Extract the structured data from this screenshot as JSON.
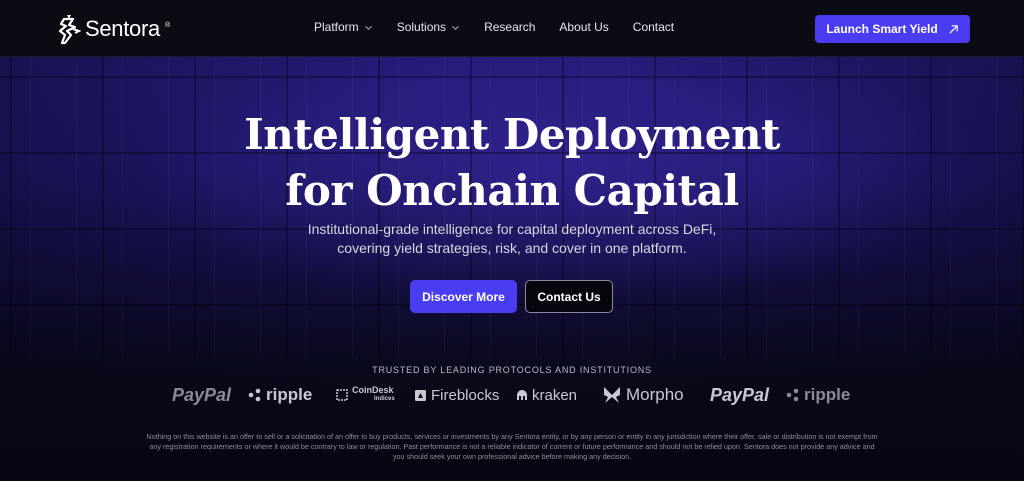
{
  "nav": {
    "logo_text": "Sentora",
    "logo_reg": "®",
    "menu": [
      {
        "label": "Platform",
        "has_dropdown": true
      },
      {
        "label": "Solutions",
        "has_dropdown": true
      },
      {
        "label": "Research",
        "has_dropdown": false
      },
      {
        "label": "About Us",
        "has_dropdown": false
      },
      {
        "label": "Contact",
        "has_dropdown": false
      }
    ],
    "cta_label": "Launch Smart Yield",
    "cta_icon": "arrow-up-right-icon"
  },
  "hero": {
    "title_line1": "Intelligent Deployment",
    "title_line2": "for Onchain Capital",
    "subtitle_line1": "Institutional-grade intelligence for capital deployment across DeFi,",
    "subtitle_line2": "covering yield strategies, risk, and cover in one platform.",
    "primary_button": "Discover More",
    "secondary_button": "Contact Us"
  },
  "trusted": {
    "heading": "TRUSTED BY LEADING PROTOCOLS AND INSTITUTIONS",
    "logos": [
      "PayPal",
      "ripple",
      "CoinDesk",
      "Indices",
      "Fireblocks",
      "kraken",
      "Morpho",
      "PayPal",
      "ripple"
    ]
  },
  "disclaimer": {
    "line1": "Nothing on this website is an offer to sell or a solicitation of an offer to buy products, services or investments by any Sentora entity, or by any person or entity in any jurisdiction where their offer, sale or distribution is not exempt from",
    "line2": "any registration requirements or where it would be contrary to law or regulation. Past performance is not a reliable indicator of current or future performance and should not be relied upon. Sentora does not provide any advice and",
    "line3": "you should seek your own professional advice before making any decision."
  },
  "colors": {
    "accent": "#4a3cf0",
    "nav_bg": "#0b0b14",
    "hero_top": "#2a1f8a",
    "page_bg": "#08080f"
  }
}
